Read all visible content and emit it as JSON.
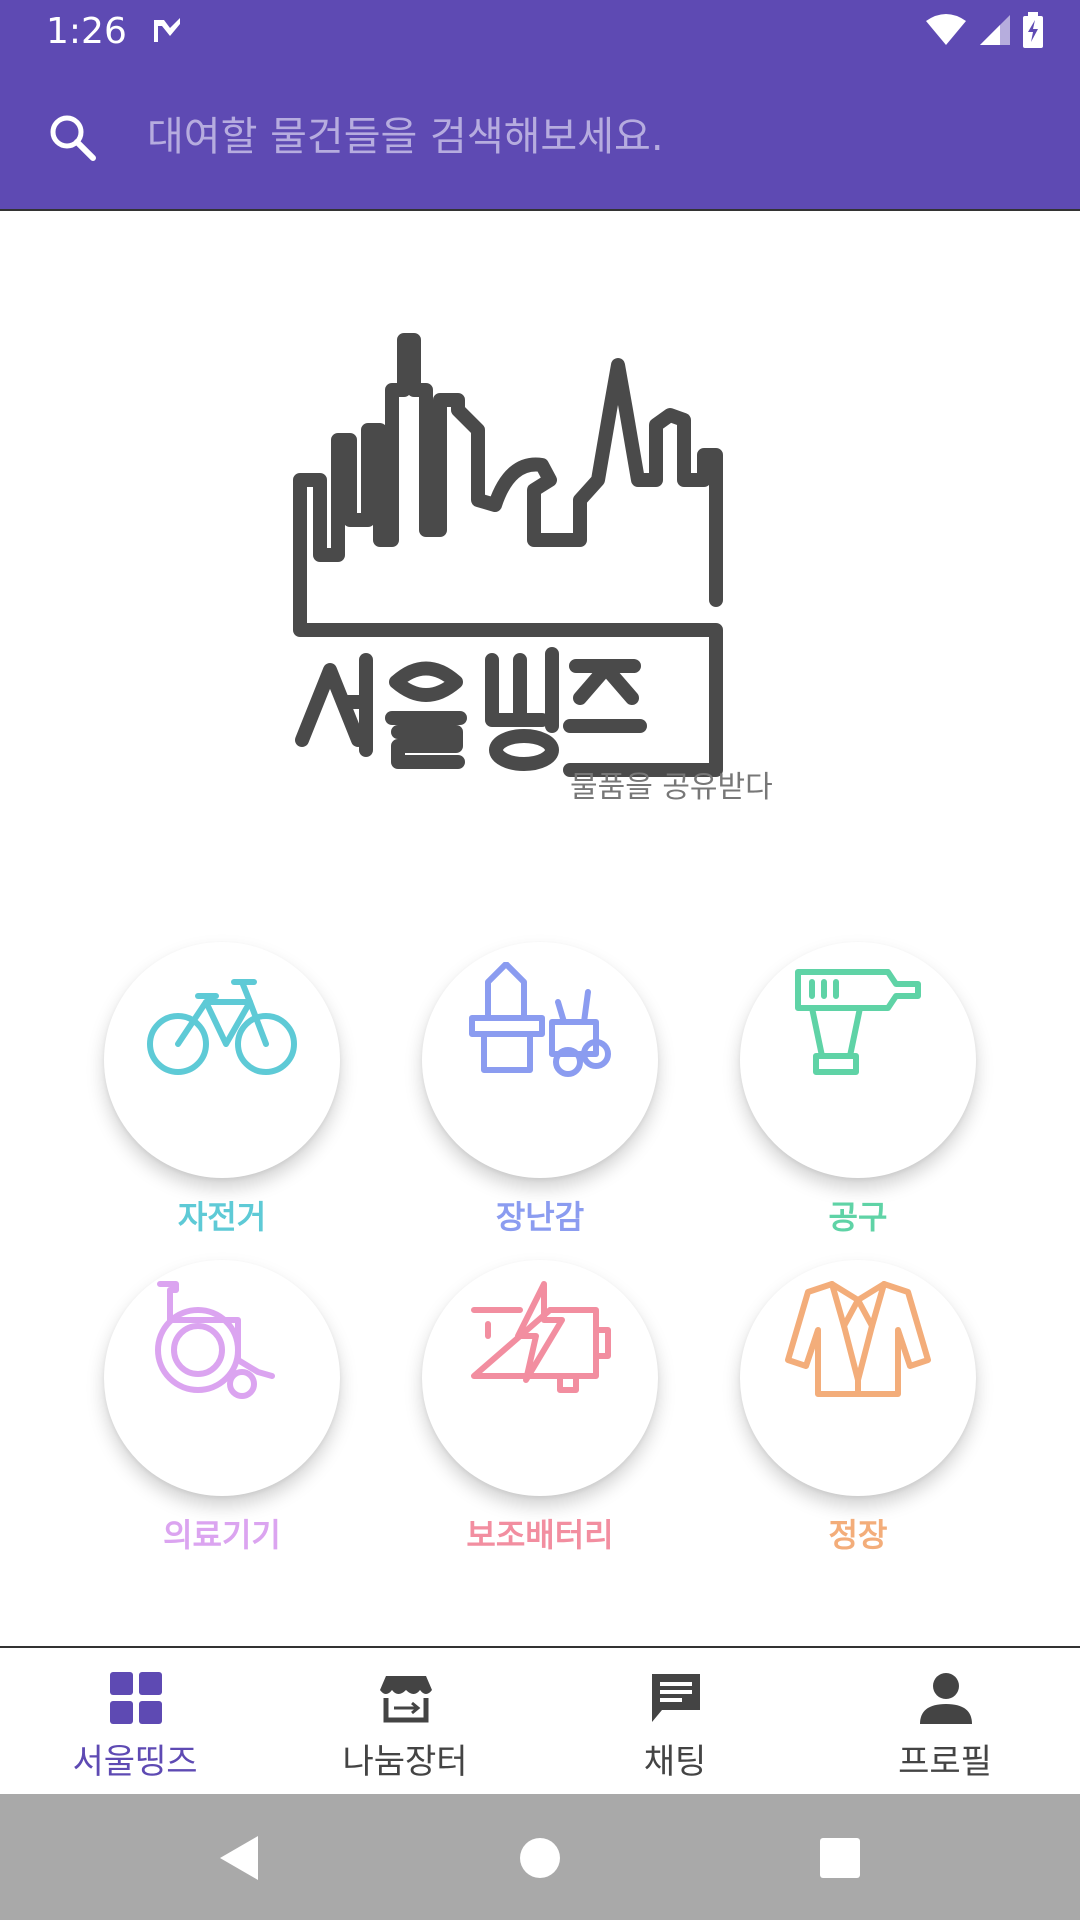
{
  "status_bar": {
    "time": "1:26",
    "icons": [
      "notification-check-icon",
      "wifi-icon",
      "signal-icon",
      "battery-charging-icon"
    ]
  },
  "search": {
    "placeholder": "대여할 물건들을 검색해보세요.",
    "value": ""
  },
  "logo": {
    "wordmark": "서울띵즈",
    "tagline": "물품을 공유받다"
  },
  "categories": [
    {
      "label": "자전거",
      "icon": "bicycle-icon",
      "color": "#5ecad6"
    },
    {
      "label": "장난감",
      "icon": "toy-icon",
      "color": "#8b9cf0"
    },
    {
      "label": "공구",
      "icon": "drill-icon",
      "color": "#5fd3a6"
    },
    {
      "label": "의료기기",
      "icon": "wheelchair-icon",
      "color": "#dba4f0"
    },
    {
      "label": "보조배터리",
      "icon": "battery-pack-icon",
      "color": "#f28ea0"
    },
    {
      "label": "정장",
      "icon": "suit-jacket-icon",
      "color": "#f3ad7a"
    }
  ],
  "bottom_nav": [
    {
      "label": "서울띵즈",
      "icon": "grid-icon",
      "active": true
    },
    {
      "label": "나눔장터",
      "icon": "store-icon",
      "active": false
    },
    {
      "label": "채팅",
      "icon": "chat-icon",
      "active": false
    },
    {
      "label": "프로필",
      "icon": "person-icon",
      "active": false
    }
  ],
  "colors": {
    "primary": "#5e4ab3",
    "nav_active": "#5e4ab3",
    "nav_inactive": "#444444",
    "system_nav": "#a9a9a9"
  }
}
